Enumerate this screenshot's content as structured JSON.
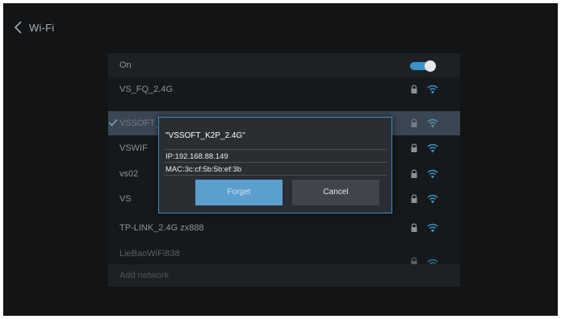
{
  "header": {
    "title": "Wi-Fi"
  },
  "toggle_row": {
    "label": "On",
    "state": "on"
  },
  "networks": [
    {
      "ssid": "VS_FQ_2.4G",
      "locked": true,
      "selected": false
    },
    {
      "ssid": "VSSOFT_K2P_2.4G",
      "locked": true,
      "selected": true
    },
    {
      "ssid": "VSWIF",
      "locked": true,
      "selected": false
    },
    {
      "ssid": "vs02",
      "locked": true,
      "selected": false
    },
    {
      "ssid": "VS",
      "locked": true,
      "selected": false
    },
    {
      "ssid": "TP-LINK_2.4G zx888",
      "locked": true,
      "selected": false
    },
    {
      "ssid": "LieBaoWiFi838",
      "locked": true,
      "selected": false
    }
  ],
  "add_network": {
    "label": "Add network"
  },
  "dialog": {
    "title": "\"VSSOFT_K2P_2.4G\"",
    "ip": "IP:192.168.88.149",
    "mac": "MAC:3c:cf:5b:5b:ef:3b",
    "forget_label": "Forget",
    "cancel_label": "Cancel"
  },
  "colors": {
    "accent": "#3b93c7",
    "background": "#121416",
    "selected_row": "#3a4654"
  },
  "icons": {
    "back": "chevron-left-icon",
    "lock": "lock-icon",
    "wifi": "wifi-icon",
    "check": "check-icon"
  }
}
